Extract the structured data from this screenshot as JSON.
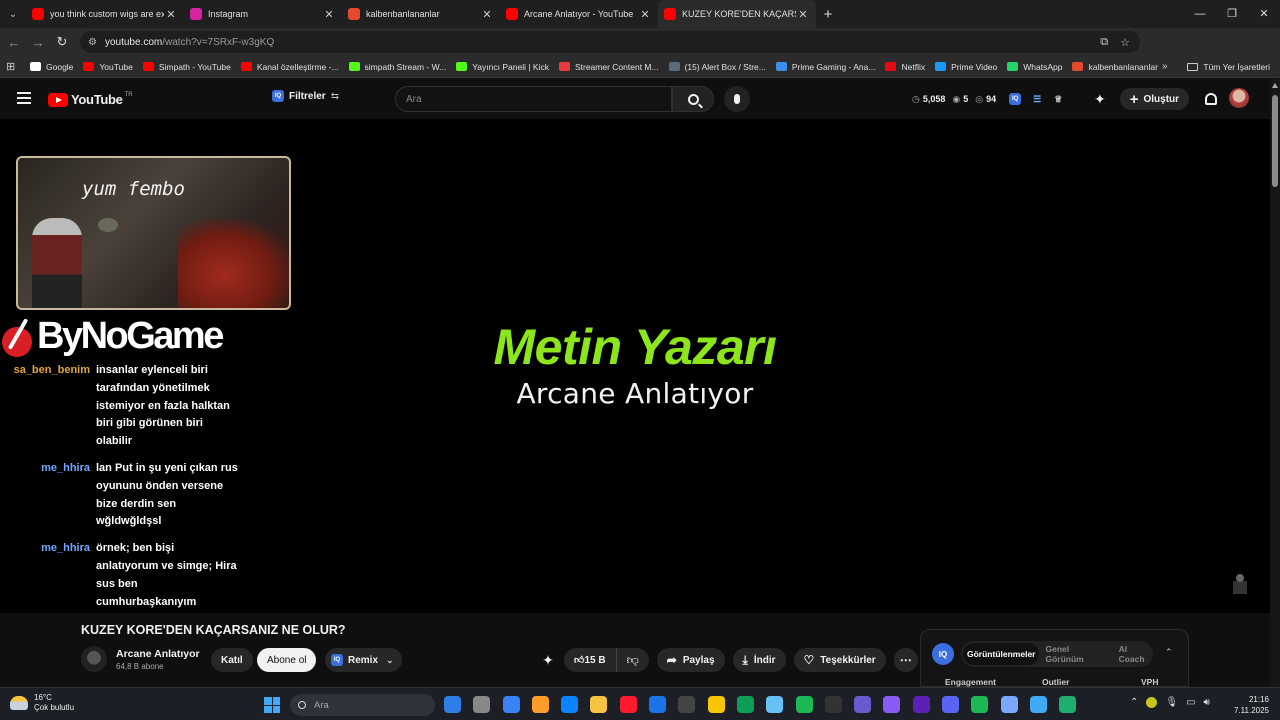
{
  "browser": {
    "tabs": [
      {
        "label": "you think custom wigs are expe",
        "color": "#ff0000",
        "active": false
      },
      {
        "label": "Instagram",
        "color": "#d6249f",
        "active": false
      },
      {
        "label": "kalbenbanlananlar",
        "color": "#e64a2e",
        "active": false
      },
      {
        "label": "Arcane Anlatıyor - YouTube",
        "color": "#ff0000",
        "active": false
      },
      {
        "label": "KUZEY KORE'DEN KAÇARSANIZ",
        "color": "#ff0000",
        "active": true
      }
    ],
    "url_host": "youtube.com",
    "url_path": "/watch?v=7SRxF-w3gKQ",
    "bookmarks": [
      {
        "label": "Google",
        "color": "#ffffff"
      },
      {
        "label": "YouTube",
        "color": "#ff0000"
      },
      {
        "label": "Simpath - YouTube",
        "color": "#ff0000"
      },
      {
        "label": "Kanal özelleştirme -...",
        "color": "#ff0000"
      },
      {
        "label": "simpath Stream - W...",
        "color": "#53fc18"
      },
      {
        "label": "Yayıncı Paneli | Kick",
        "color": "#53fc18"
      },
      {
        "label": "Streamer Content M...",
        "color": "#e83a3a"
      },
      {
        "label": "(15) Alert Box / Stre...",
        "color": "#5a6b7a"
      },
      {
        "label": "Prime Gaming - Ana...",
        "color": "#3b8eea"
      },
      {
        "label": "Netflix",
        "color": "#e50914"
      },
      {
        "label": "Prime Video",
        "color": "#1a98ff"
      },
      {
        "label": "WhatsApp",
        "color": "#25d366"
      },
      {
        "label": "kalbenbanlananlar",
        "color": "#e64a2e"
      }
    ],
    "all_bookmarks": "Tüm Yer İşaretleri"
  },
  "youtube": {
    "logo_text": "YouTube",
    "country": "TR",
    "filters_label": "Filtreler",
    "search_placeholder": "Ara",
    "stats": {
      "watch": "5,058",
      "views": "5",
      "eye": "94"
    },
    "create_label": "Oluştur"
  },
  "video": {
    "cam_caption": "yum fembo",
    "sponsor": "ByNoGame",
    "title_main": "Metin Yazarı",
    "title_sub": "Arcane Anlatıyor",
    "chat": [
      {
        "user": "sa_ben_benim",
        "color": "#e2a33c",
        "text": "insanlar eylenceli biri tarafından yönetilmek istemiyor en fazla halktan biri gibi görünen biri olabilir"
      },
      {
        "user": "me_hhira",
        "color": "#6fa8ff",
        "text": "lan Put in şu yeni çıkan rus oyununu önden versene bize derdin sen wğldwğldşsl"
      },
      {
        "user": "me_hhira",
        "color": "#6fa8ff",
        "text": "örnek; ben bişi anlatıyorum ve simge; Hira sus ben cumhurbaşkanıyım"
      }
    ]
  },
  "below": {
    "title": "KUZEY KORE'DEN KAÇARSANIZ NE OLUR?",
    "channel": "Arcane Anlatıyor",
    "subs": "64,8 B abone",
    "join": "Katıl",
    "subscribe": "Abone ol",
    "remix": "Remix",
    "likes": "15 B",
    "share": "Paylaş",
    "download": "İndir",
    "thanks": "Teşekkürler"
  },
  "iq_panel": {
    "tabs": [
      "Görüntülenmeler",
      "Genel Görünüm",
      "AI Coach"
    ],
    "columns": [
      "Engagement",
      "Outlier",
      "VPH"
    ]
  },
  "taskbar": {
    "temp": "16°C",
    "weather": "Çok bulutlu",
    "search": "Ara",
    "time": "21:16",
    "date": "7.11.2025",
    "apps": [
      "#2d7ee6",
      "#888",
      "#3b82f6",
      "#ff9c2a",
      "#0a84ff",
      "#f5c242",
      "#ff1b2d",
      "#1a73e8",
      "#444",
      "#f7c600",
      "#0f9d58",
      "#66c0f4",
      "#1db954",
      "#333",
      "#6a5acd",
      "#8a5cf6",
      "#5b21b6",
      "#5865f2",
      "#1db954",
      "#7aa8ff",
      "#3fa9f5",
      "#1fae6b"
    ]
  }
}
